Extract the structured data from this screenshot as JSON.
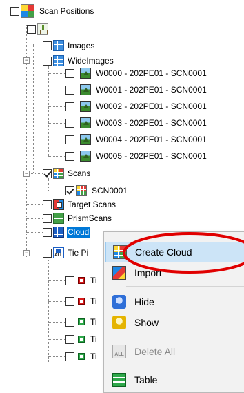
{
  "tree": {
    "root_label": "Scan Positions",
    "images_label": "Images",
    "wideimages_label": "WideImages",
    "wideimages_items": [
      "W0000 - 202PE01 - SCN0001",
      "W0001 - 202PE01 - SCN0001",
      "W0002 - 202PE01 - SCN0001",
      "W0003 - 202PE01 - SCN0001",
      "W0004 - 202PE01 - SCN0001",
      "W0005 - 202PE01 - SCN0001"
    ],
    "scans_label": "Scans",
    "scan_item": "SCN0001",
    "target_scans_label": "Target Scans",
    "prism_scans_label": "PrismScans",
    "cloud_label": "Cloud",
    "tiepoints_label": "Tie Pi",
    "tie_items": [
      "Ti",
      "Ti",
      "Ti",
      "Ti",
      "Ti"
    ]
  },
  "context_menu": {
    "items": [
      {
        "label": "Create Cloud",
        "icon": "create-cloud-icon",
        "highlighted": true
      },
      {
        "label": "Import",
        "icon": "import-icon"
      },
      {
        "label": "Hide",
        "icon": "hide-icon"
      },
      {
        "label": "Show",
        "icon": "show-icon"
      },
      {
        "label": "Delete All",
        "icon": "delete-all-icon",
        "disabled": true
      },
      {
        "label": "Table",
        "icon": "table-icon"
      }
    ]
  },
  "colors": {
    "selection": "#0078d7",
    "menu_highlight": "#cce4f7",
    "annotation": "#e00000"
  }
}
